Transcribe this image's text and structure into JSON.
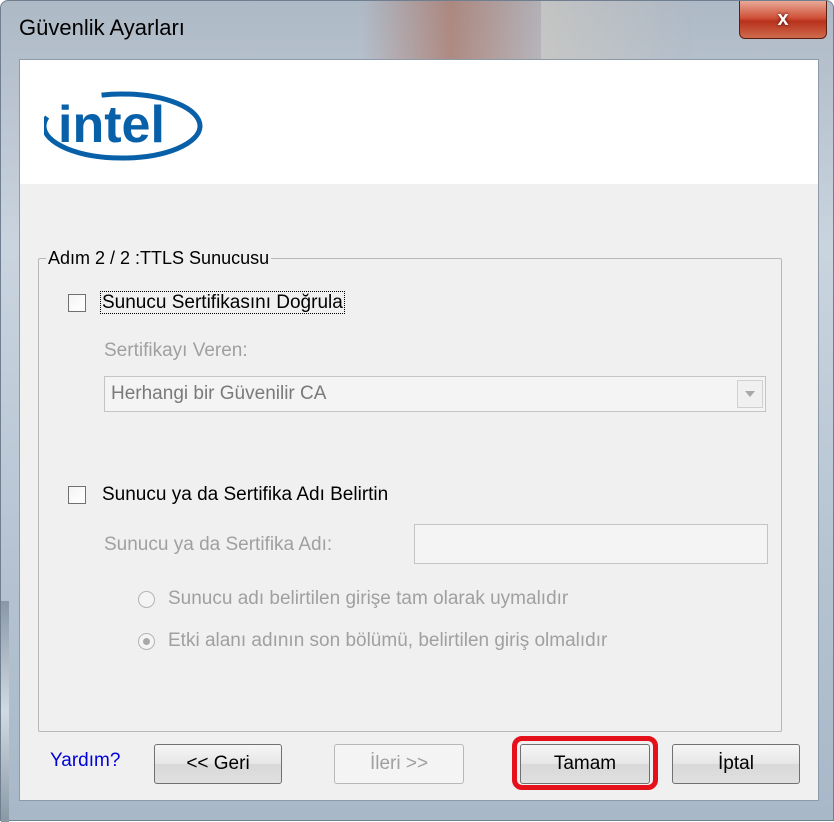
{
  "window": {
    "title": "Güvenlik Ayarları",
    "close_glyph": "x"
  },
  "logo": {
    "text": "intel",
    "color": "#0860a8"
  },
  "group": {
    "legend": "Adım 2 / 2 :TTLS Sunucusu",
    "verify_cert": {
      "label": "Sunucu Sertifikasını Doğrula",
      "checked": false
    },
    "issuer": {
      "label": "Sertifikayı Veren:",
      "selected_value": "Herhangi bir Güvenilir CA"
    },
    "specify_name": {
      "label": "Sunucu ya da Sertifika Adı Belirtin",
      "checked": false
    },
    "name_field": {
      "label": "Sunucu ya da Sertifika Adı:",
      "value": ""
    },
    "radio_exact": {
      "label": "Sunucu adı belirtilen girişe tam olarak uymalıdır",
      "selected": false
    },
    "radio_suffix": {
      "label": "Etki alanı adının son bölümü, belirtilen giriş olmalıdır",
      "selected": true
    }
  },
  "footer": {
    "help": "Yardım?",
    "back": "<< Geri",
    "next": "İleri >>",
    "ok": "Tamam",
    "cancel": "İptal"
  },
  "colors": {
    "accent_highlight": "#e4101a",
    "link": "#0000d8"
  }
}
